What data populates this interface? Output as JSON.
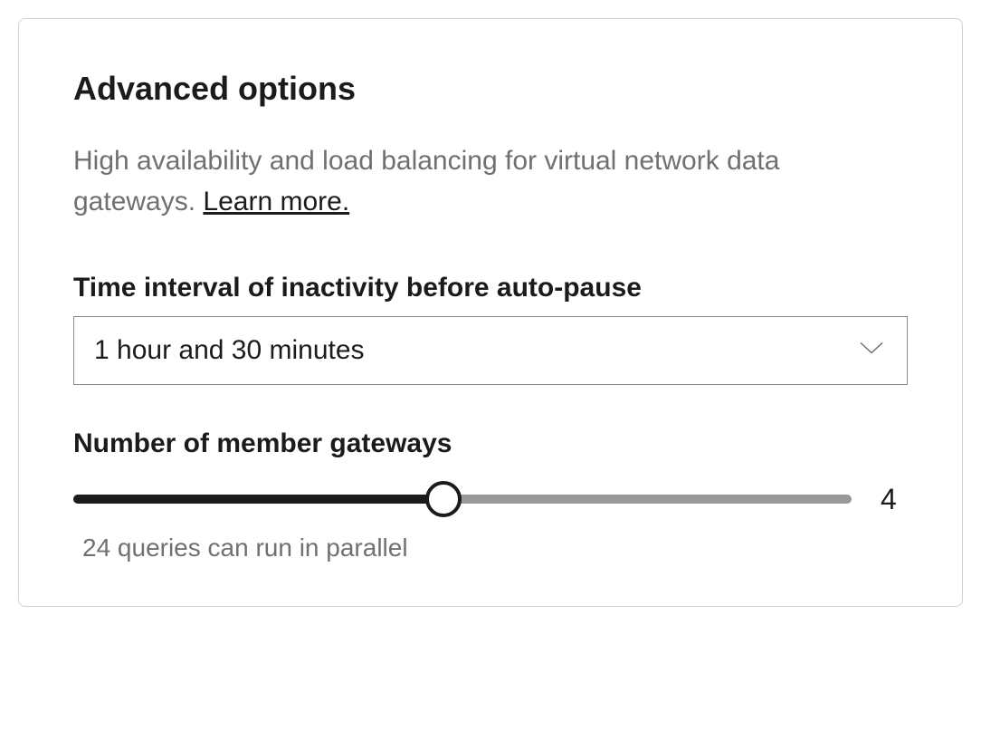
{
  "card": {
    "title": "Advanced options",
    "description_prefix": "High availability and load balancing for virtual network data gateways. ",
    "description_link": "Learn more."
  },
  "time_interval": {
    "label": "Time interval of inactivity before auto-pause",
    "selected": "1 hour and 30 minutes"
  },
  "gateways": {
    "label": "Number of member gateways",
    "value": "4",
    "fill_percent": "47.5",
    "hint": "24 queries can run in parallel"
  }
}
